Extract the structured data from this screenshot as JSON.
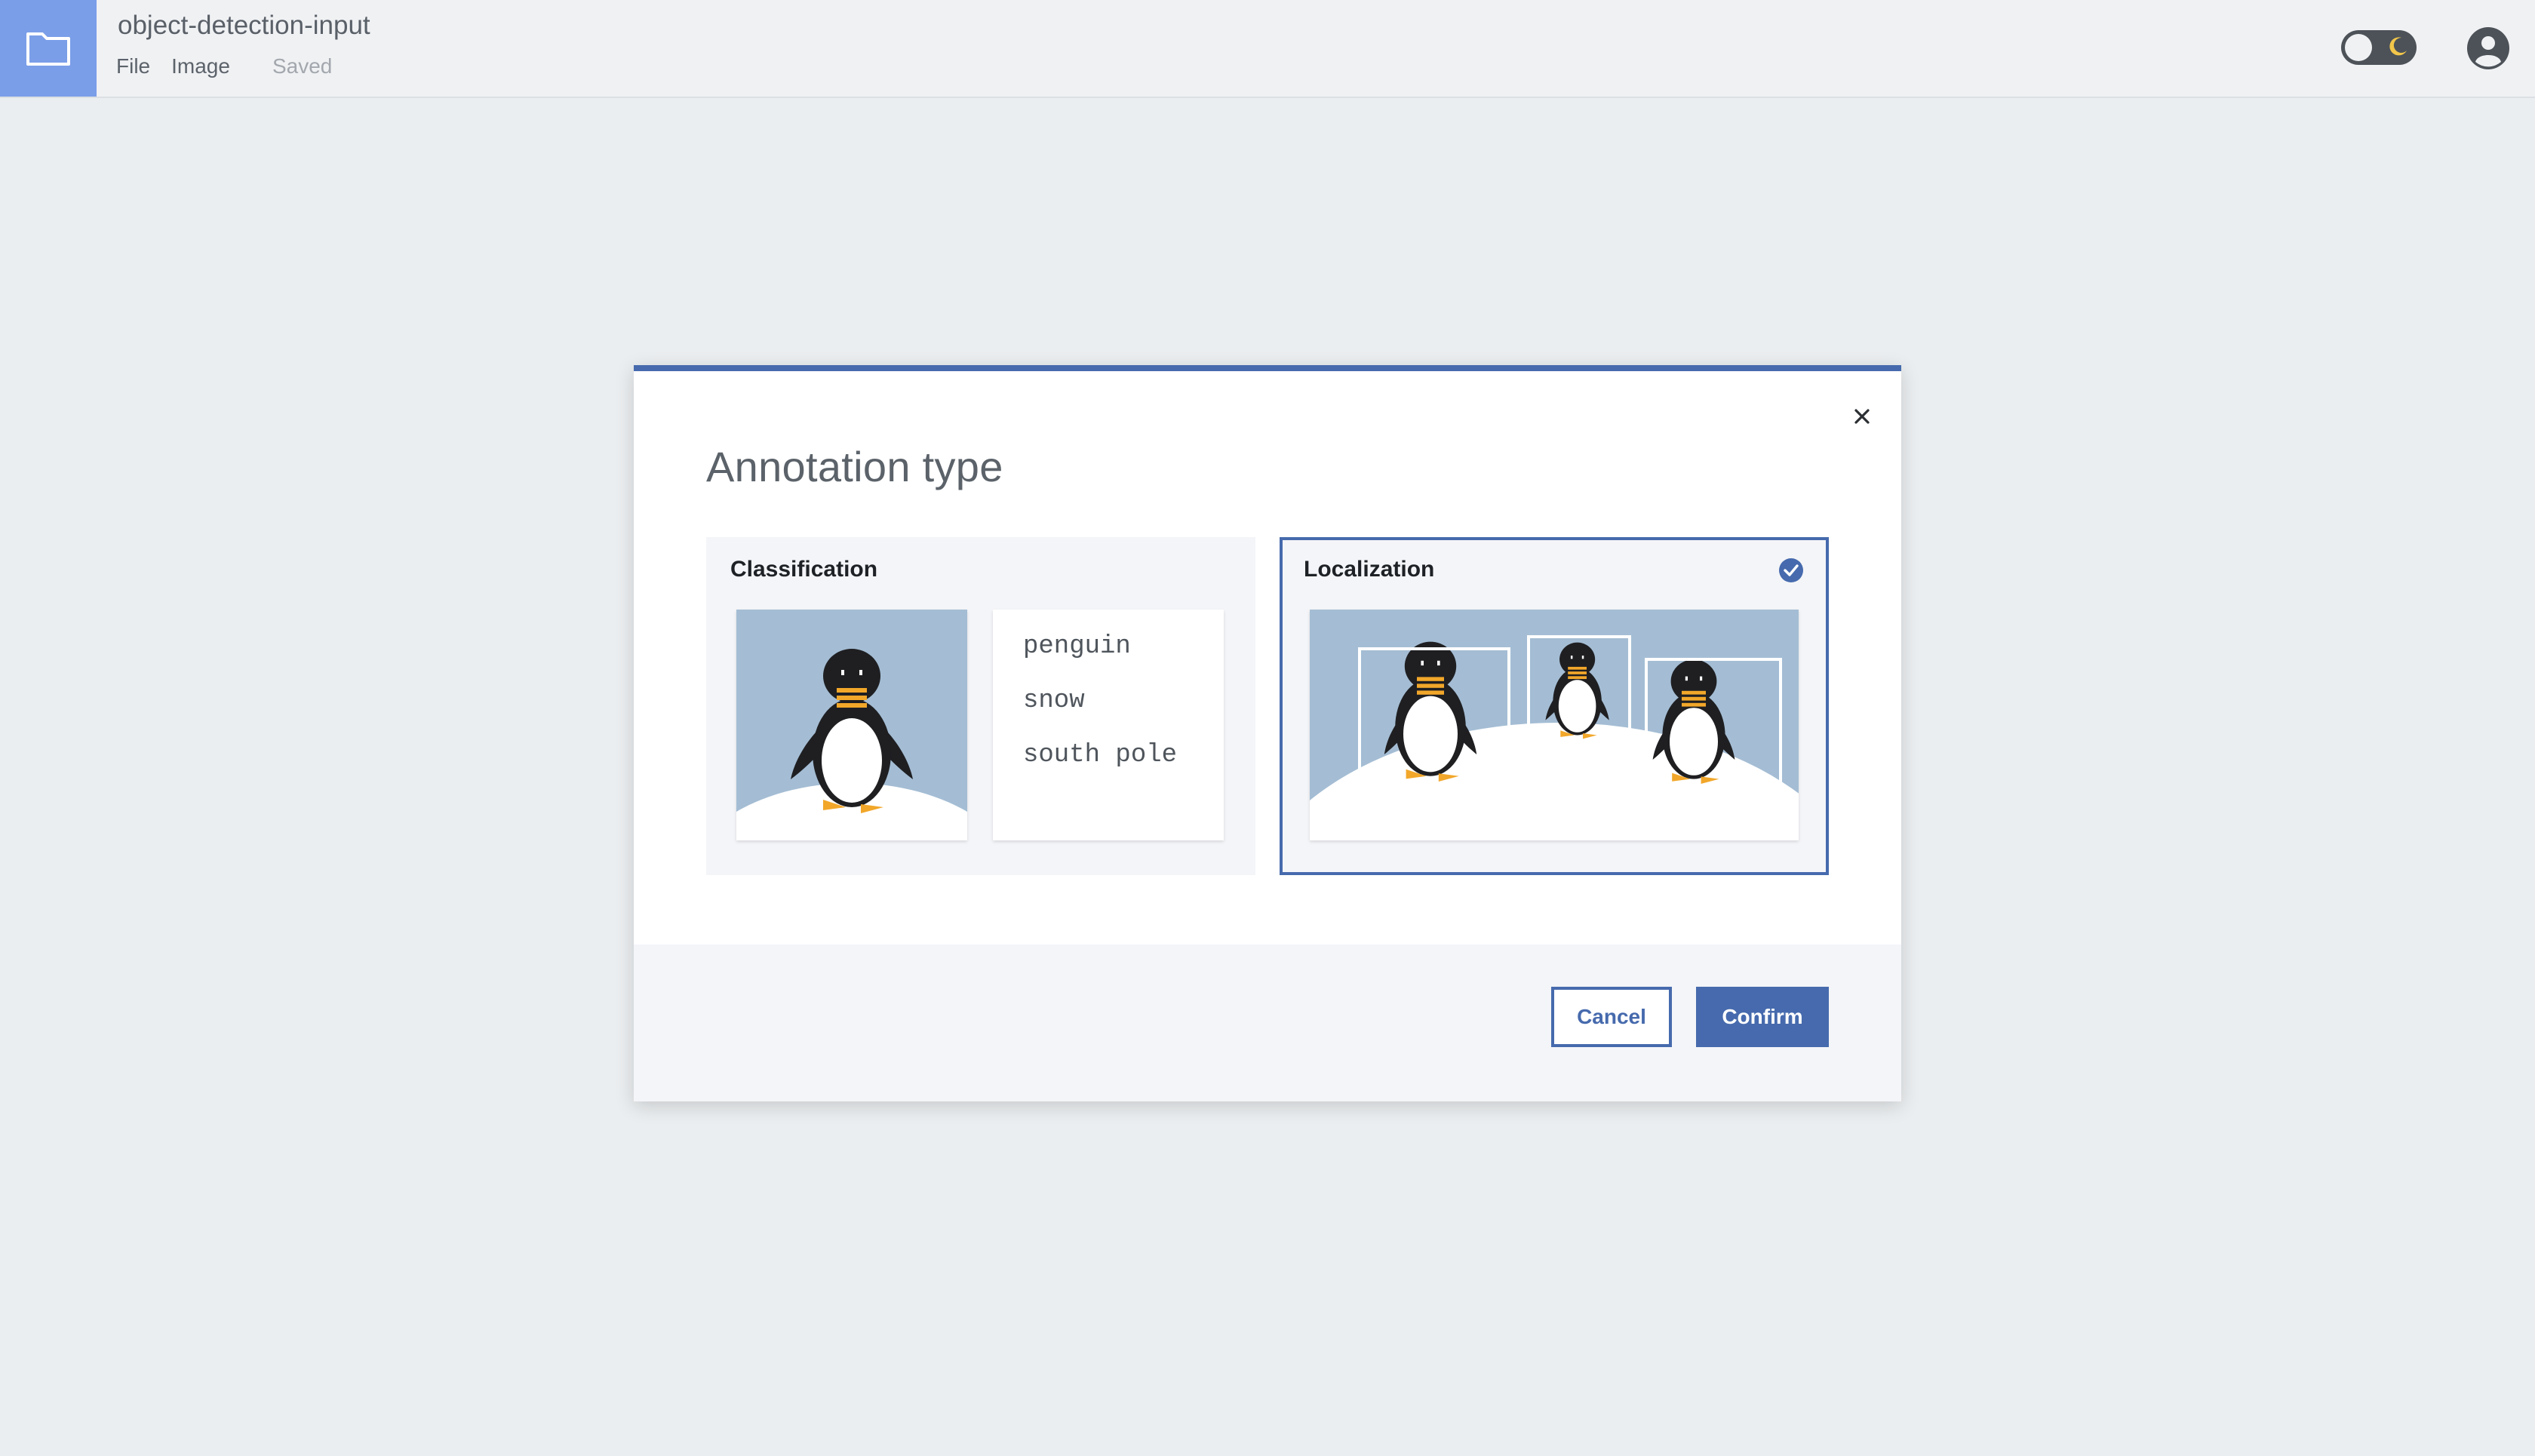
{
  "app": {
    "document_title": "object-detection-input",
    "menu": [
      "File",
      "Image"
    ],
    "save_status": "Saved"
  },
  "icons": {
    "folder": "folder-icon",
    "theme_toggle": "moon-icon",
    "account": "user-avatar-icon",
    "close": "close-icon",
    "selected": "checkmark-icon"
  },
  "modal": {
    "title": "Annotation type",
    "options": [
      {
        "label": "Classification",
        "selected": false,
        "tags": [
          "penguin",
          "snow",
          "south pole"
        ]
      },
      {
        "label": "Localization",
        "selected": true
      }
    ],
    "cancel_label": "Cancel",
    "confirm_label": "Confirm"
  },
  "colors": {
    "accent": "#466aad",
    "folder_button": "#7a9ee8",
    "image_background": "#a4bdd4",
    "page_background": "#ebeef0"
  }
}
